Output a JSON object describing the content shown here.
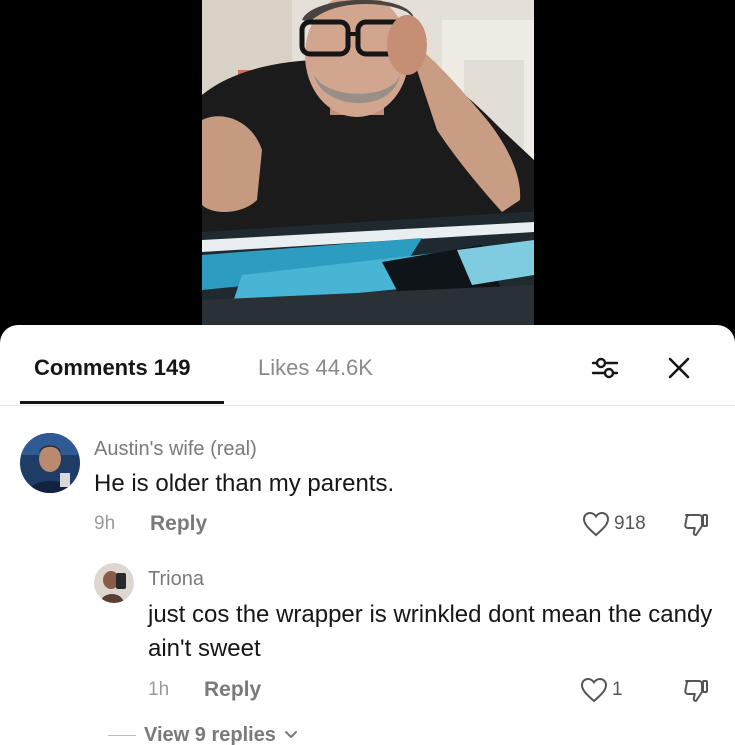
{
  "tabs": {
    "comments_label": "Comments 149",
    "likes_label": "Likes 44.6K"
  },
  "icons": {
    "filter": "sliders-icon",
    "close": "close-icon",
    "like": "heart-outline-icon",
    "dislike": "thumbs-down-icon",
    "chevron": "chevron-down-icon"
  },
  "comments": [
    {
      "username": "Austin's wife (real)",
      "text": "He is older than my parents.",
      "time": "9h",
      "reply_label": "Reply",
      "likes": "918"
    },
    {
      "username": "Triona",
      "text": "just cos the wrapper is wrinkled dont mean the candy ain't sweet",
      "time": "1h",
      "reply_label": "Reply",
      "likes": "1"
    }
  ],
  "view_replies_label": "View 9 replies",
  "colors": {
    "background": "#000000",
    "sheet": "#ffffff",
    "primary_text": "#161616",
    "secondary_text": "#7a7a7a",
    "divider": "#e6e6e6"
  }
}
